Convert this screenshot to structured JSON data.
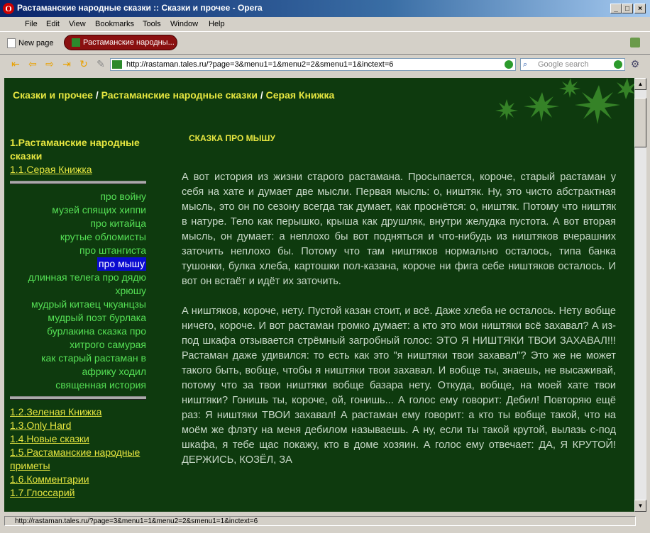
{
  "window": {
    "title": "Растаманские народные сказки :: Сказки и прочее - Opera",
    "minimize": "_",
    "maximize": "□",
    "close": "×"
  },
  "menu": [
    "File",
    "Edit",
    "View",
    "Bookmarks",
    "Tools",
    "Window",
    "Help"
  ],
  "tabs": {
    "new_page_label": "New page",
    "active_tab_label": "Растаманские народны..."
  },
  "address": {
    "url": "http://rastaman.tales.ru/?page=3&menu1=1&menu2=2&smenu1=1&inctext=6",
    "search_placeholder": "Google search"
  },
  "page": {
    "breadcrumb": {
      "part1": "Сказки и прочее",
      "sep": " / ",
      "part2": "Растаманские народные сказки",
      "part3": "Серая Книжка"
    },
    "sidebar": {
      "section_title": "1.Растаманские народные сказки",
      "current_book": "1.1.Серая Книжка",
      "stories": [
        "про войну",
        "музей спящих хиппи",
        "про китайца",
        "крутые обломисты",
        "про штангиста",
        "про мышу",
        "длинная телега про дядю хрюшу",
        "мудрый китаец чкуанцзы",
        "мудрый поэт бурлака",
        "бурлакина сказка про хитрого самурая",
        "как старый растаман в африку ходил",
        "священная история"
      ],
      "other_books": [
        "1.2.Зеленая Книжка",
        "1.3.Only Hard",
        "1.4.Новые сказки",
        "1.5.Растаманские народные приметы",
        "1.6.Комментарии",
        "1.7.Глоссарий"
      ]
    },
    "story_title": "СКАЗКА ПРО МЫШУ",
    "paragraphs": [
      "А вот история из жизни старого растамана. Просыпается, короче, старый растаман у себя на хате и думает две мысли. Первая мысль: о, ништяк. Ну, это чисто абстрактная мысль, это он по сезону всегда так думает, как проснётся: о, ништяк. Потому что ништяк в натуре. Тело как перышко, крыша как друшляк, внутри желудка пустота. А вот вторая мысль, он думает: а неплохо бы вот подняться и что-нибудь из ништяков вчерашних заточить неплохо бы. Потому что там ништяков нормально осталось, типа банка тушонки, булка хлеба, картошки пол-казана, короче ни фига себе ништяков осталось. И вот он встаёт и идёт их заточить.",
      "А ништяков, короче, нету. Пустой казан стоит, и всё. Даже хлеба не осталось. Нету вобще ничего, короче. И вот растаман громко думает: а кто это мои ништяки всё захавал? А из-под шкафа отзывается стрёмный загробный голос: ЭТО Я НИШТЯКИ ТВОИ ЗАХАВАЛ!!! Растаман даже удивился: то есть как это \"я ништяки твои захавал\"? Это же не может такого быть, вобще, чтобы я ништяки твои захавал. И вобще ты, знаешь, не высаживай, потому что за твои ништяки вобще базара нету. Откуда, вобще, на моей хате твои ништяки? Гонишь ты, короче, ой, гонишь... А голос ему говорит: Дебил! Повторяю ещё раз: Я ништяки ТВОИ захавал! А растаман ему говорит: а кто ты вобще такой, что на моём же флэту на меня дебилом называешь. А ну, если ты такой крутой, вылазь с-под шкафа, я тебе щас покажу, кто в доме хозяин. А голос ему отвечает: ДА, Я КРУТОЙ! ДЕРЖИСЬ, КОЗЁЛ, ЗА"
    ]
  },
  "status": {
    "text": "http://rastaman.tales.ru/?page=3&menu1=1&menu2=2&smenu1=1&inctext=6"
  },
  "colors": {
    "page_bg": "#0e3a0e",
    "heading_yellow": "#e6e640",
    "story_link_green": "#55e055",
    "active_highlight": "#0a0ad0"
  }
}
